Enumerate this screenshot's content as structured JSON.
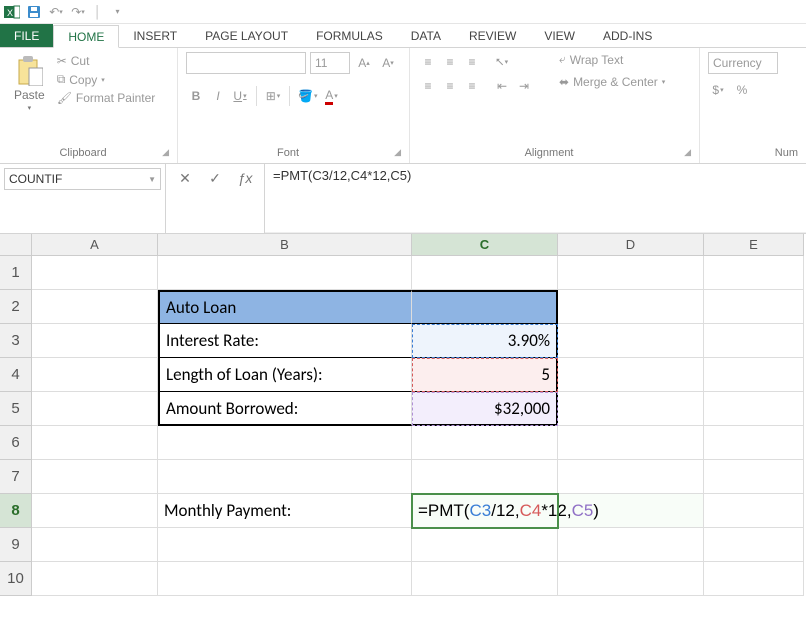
{
  "qat": {
    "undo_dd": "▾",
    "redo_dd": "▾",
    "customize_dd": "▾"
  },
  "tabs": {
    "file": "FILE",
    "home": "HOME",
    "insert": "INSERT",
    "page_layout": "PAGE LAYOUT",
    "formulas": "FORMULAS",
    "data": "DATA",
    "review": "REVIEW",
    "view": "VIEW",
    "addins": "ADD-INS"
  },
  "ribbon": {
    "clipboard": {
      "paste": "Paste",
      "cut": "Cut",
      "copy": "Copy",
      "format_painter": "Format Painter",
      "title": "Clipboard"
    },
    "font": {
      "name_placeholder": "",
      "size": "11",
      "title": "Font",
      "bold": "B",
      "italic": "I",
      "underline": "U"
    },
    "alignment": {
      "wrap": "Wrap Text",
      "merge": "Merge & Center",
      "title": "Alignment"
    },
    "number": {
      "format": "Currency",
      "title": "Num",
      "dollar": "$",
      "percent": "%"
    }
  },
  "namebox": "COUNTIF",
  "fbar_btns": {
    "cancel": "✕",
    "enter": "✓",
    "fx": "ƒx"
  },
  "formula_text": "=PMT(C3/12,C4*12,C5)",
  "columns": [
    "A",
    "B",
    "C",
    "D",
    "E"
  ],
  "active_col_index": 2,
  "active_row": 8,
  "sheet": {
    "b2": "Auto Loan",
    "b3": "Interest Rate:",
    "c3": "3.90%",
    "b4": "Length of Loan (Years):",
    "c4": "5",
    "b5": "Amount Borrowed:",
    "c5": "$32,000",
    "b8": "Monthly Payment:",
    "c8": {
      "prefix": "=PMT(",
      "ref1": "C3",
      "t1": "/12,",
      "ref2": "C4",
      "t2": "*12,",
      "ref3": "C5",
      "suffix": ")"
    }
  },
  "row_count": 10
}
